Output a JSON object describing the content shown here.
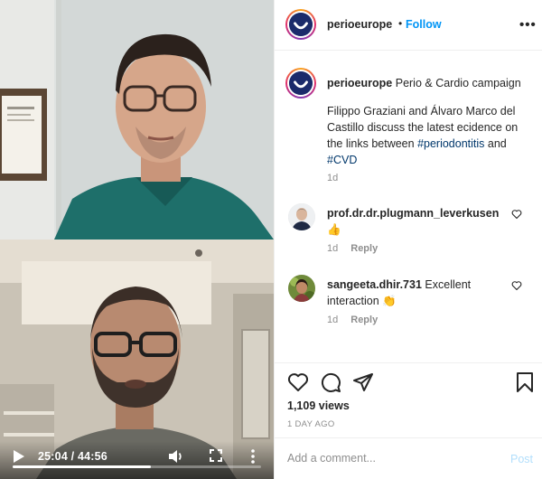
{
  "video": {
    "time_display": "25:04 / 44:56",
    "progress": 0.558
  },
  "header": {
    "username": "perioeurope",
    "dot": "•",
    "follow_label": "Follow",
    "more_label": "•••"
  },
  "caption": {
    "username": "perioeurope",
    "title": "Perio & Cardio campaign",
    "body_text": "Filippo Graziani and Álvaro Marco del Castillo discuss the latest ecidence on the links between ",
    "hashtag1": "#periodontitis",
    "and_text": " and ",
    "hashtag2": "#CVD",
    "age": "1d"
  },
  "comments": [
    {
      "username": "prof.dr.dr.plugmann_leverkusen",
      "text": "👍",
      "age": "1d",
      "reply_label": "Reply"
    },
    {
      "username": "sangeeta.dhir.731",
      "text": "Excellent interaction 👏",
      "age": "1d",
      "reply_label": "Reply"
    }
  ],
  "stats": {
    "views": "1,109 views",
    "date": "1 DAY AGO"
  },
  "add_comment": {
    "placeholder": "Add a comment...",
    "post_label": "Post"
  },
  "colors": {
    "link_blue": "#0095f6",
    "hashtag": "#00376b",
    "muted": "#8e8e8e",
    "post_disabled": "#b2dffc"
  }
}
